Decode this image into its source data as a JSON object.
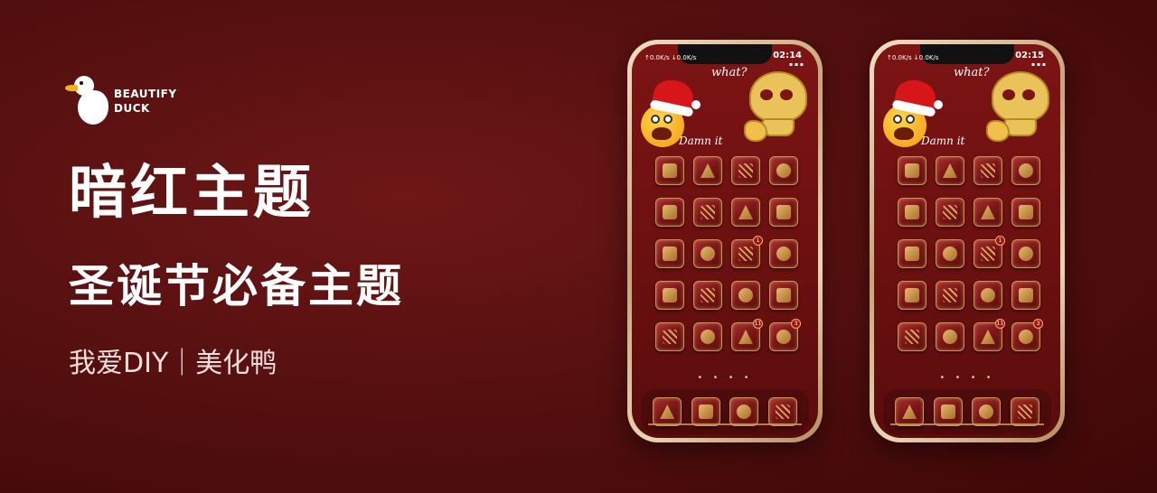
{
  "brand": {
    "name_line1": "BEAUTIFY",
    "name_line2": "DUCK",
    "logo_icon": "duck-icon"
  },
  "headline": {
    "title": "暗红主题",
    "subtitle": "圣诞节必备主题",
    "tagline": "我爱DIY｜美化鸭"
  },
  "colors": {
    "background": "#5a0f0f",
    "accent_gold": "#c79a4c",
    "text": "#ffffff"
  },
  "phones": [
    {
      "status": {
        "time": "02:14",
        "net_speed": "↑0.0K/s ↓0.0K/s",
        "right": "▪ ▪ ▪"
      },
      "widget": {
        "top_text": "what?",
        "bottom_text": "Damn it"
      },
      "badges": {
        "row3_col3": "1",
        "row5_col3": "11",
        "row5_col4": "3"
      },
      "page_dots": "• • • •"
    },
    {
      "status": {
        "time": "02:15",
        "net_speed": "↑0.0K/s ↓0.0K/s",
        "right": "▪ ▪ ▪"
      },
      "widget": {
        "top_text": "what?",
        "bottom_text": "Damn it"
      },
      "badges": {
        "row3_col3": "1",
        "row5_col3": "11",
        "row5_col4": "3"
      },
      "page_dots": "• • • •"
    }
  ]
}
